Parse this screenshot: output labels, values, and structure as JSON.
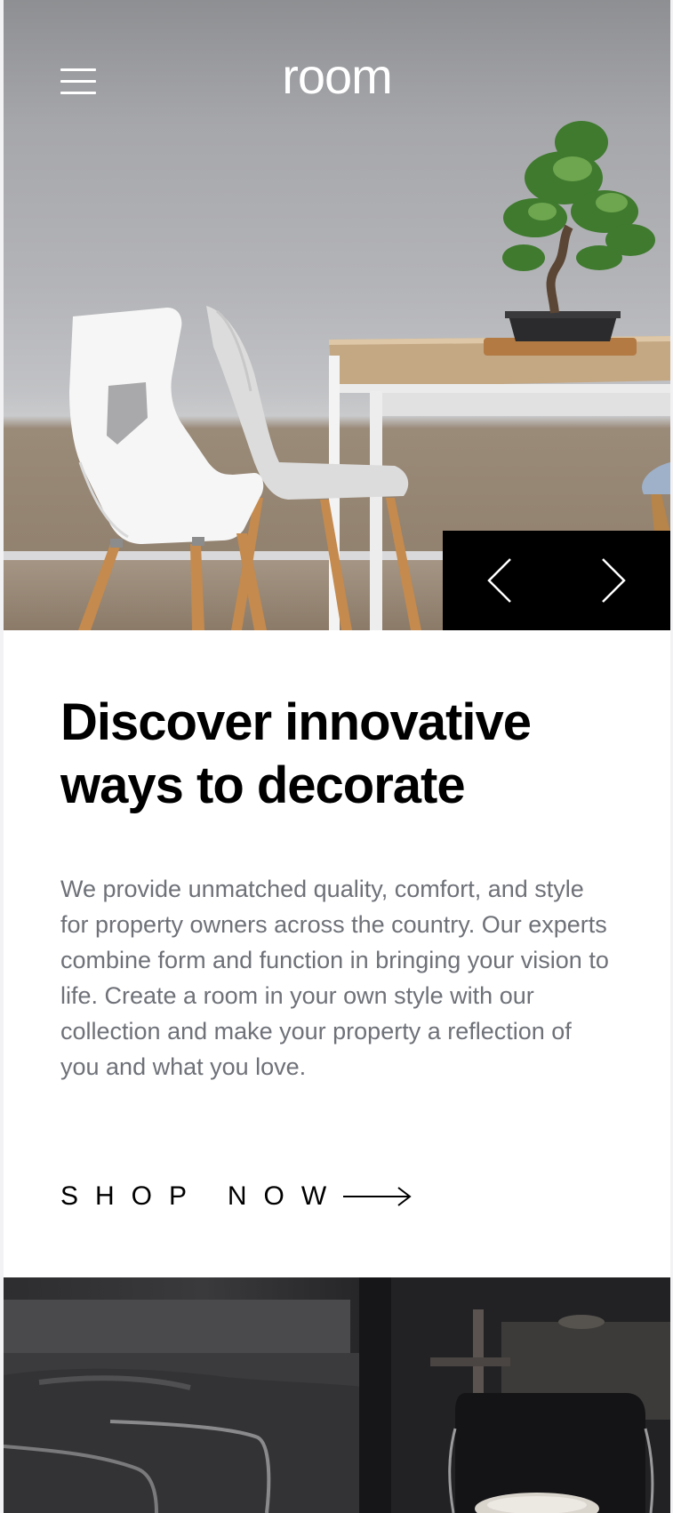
{
  "header": {
    "logo_text": "room",
    "menu_icon": "hamburger-menu-icon"
  },
  "hero": {
    "image_description_icon": "hero-furniture-image",
    "prev_icon": "chevron-left-icon",
    "next_icon": "chevron-right-icon"
  },
  "content": {
    "headline": "Discover innovative ways to decorate",
    "body": "We provide unmatched quality, comfort, and style for property owners across the country. Our experts combine form and function in bringing your vision to life. Create a room in your own style with our collection and make your property a reflection of you and what you love.",
    "cta_label": "SHOP NOW",
    "cta_icon": "arrow-right-icon"
  },
  "colors": {
    "text_primary": "#000000",
    "text_body": "#6e7178",
    "nav_background": "#000000",
    "logo": "#ffffff"
  }
}
